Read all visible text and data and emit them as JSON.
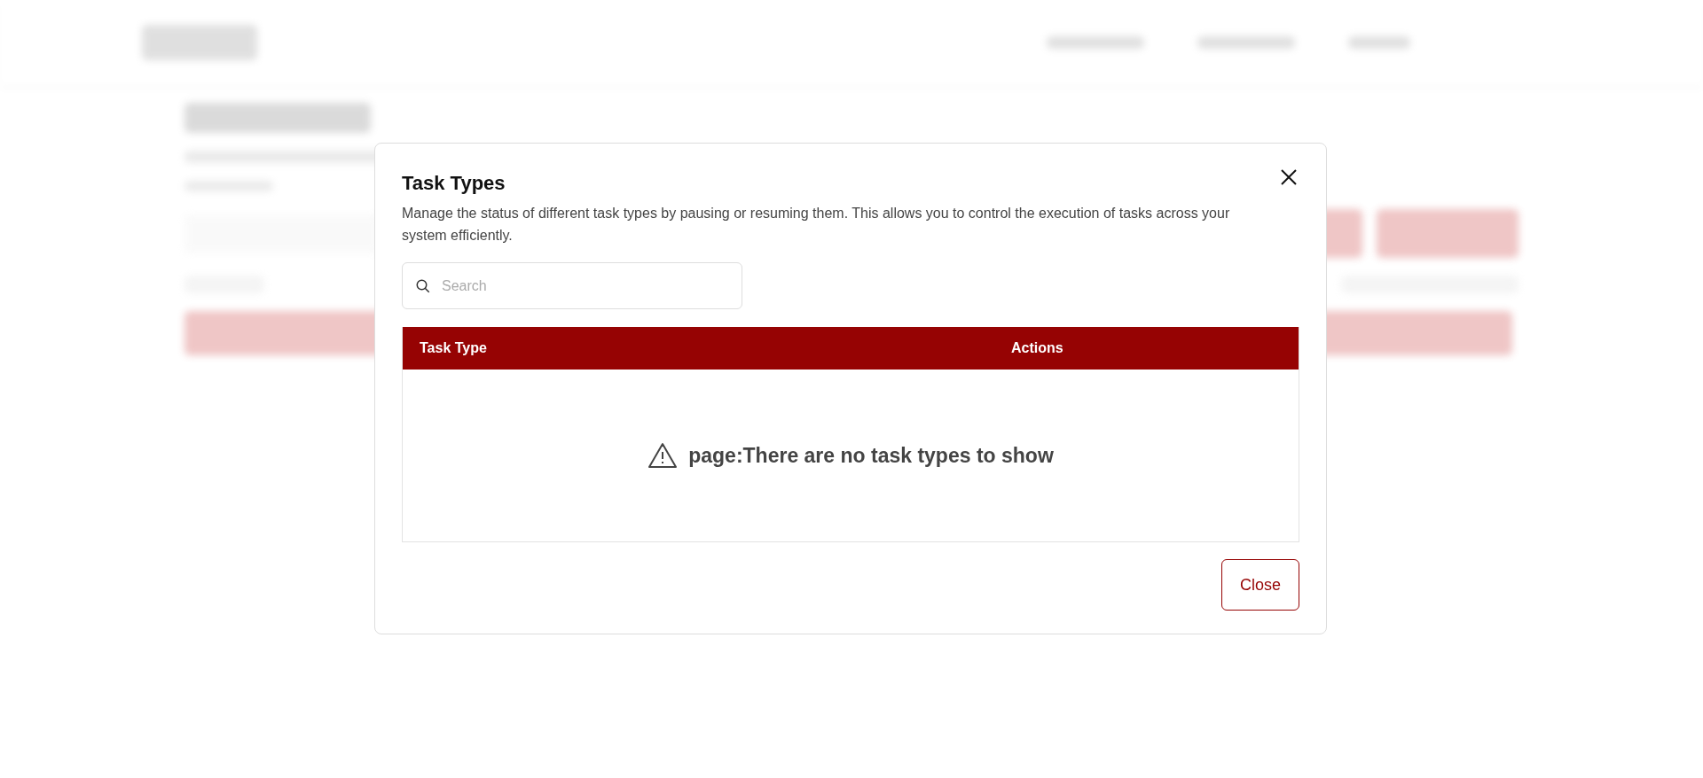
{
  "dialog": {
    "title": "Task Types",
    "description": "Manage the status of different task types by pausing or resuming them. This allows you to control the execution of tasks across your system efficiently.",
    "search": {
      "placeholder": "Search"
    },
    "table": {
      "columns": [
        {
          "label": "Task Type"
        },
        {
          "label": "Actions"
        }
      ],
      "empty_message": "page:There are no task types to show"
    },
    "buttons": [
      {
        "label": "Close",
        "kind": "outline"
      }
    ]
  }
}
